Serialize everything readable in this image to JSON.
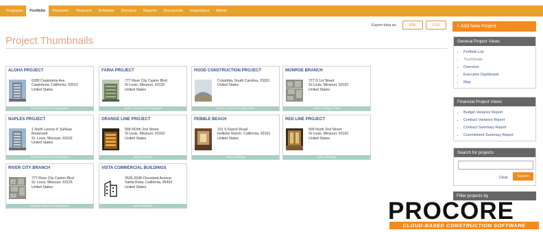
{
  "nav": {
    "items": [
      {
        "label": "Programs",
        "active": false
      },
      {
        "label": "Portfolio",
        "active": true
      },
      {
        "label": "Planroom",
        "active": false
      },
      {
        "label": "Timecard",
        "active": false
      },
      {
        "label": "Schedule",
        "active": false
      },
      {
        "label": "Directory",
        "active": false
      },
      {
        "label": "Reports",
        "active": false
      },
      {
        "label": "Documents",
        "active": false
      },
      {
        "label": "Inspections",
        "active": false
      },
      {
        "label": "Admin",
        "active": false
      }
    ]
  },
  "export": {
    "label": "Export data as:",
    "pdf": "PDF",
    "csv": "CSV"
  },
  "page_title": "Project Thumbnails",
  "projects": [
    {
      "name": "ALOHA PROJECT",
      "address": [
        "6309 Carpinteria Ave",
        "Carpinteria, California, 93013",
        "United States"
      ],
      "status": "Active | Course of Construction",
      "thumb": "tall-building"
    },
    {
      "name": "FARIA PROJECT",
      "address": [
        "777 River City Casino Blvd",
        "St Louis, Missouri, 63125",
        "United States"
      ],
      "status": "Active | Course of Construction",
      "thumb": "green-building"
    },
    {
      "name": "HOOD CONSTRUCTION PROJECT",
      "address": [
        "Columbia, South Carolina, 29201",
        "United States"
      ],
      "status": "Active | Course of Construction",
      "thumb": "arena"
    },
    {
      "name": "MONROE BRANCH",
      "address": [
        "727 N 1st Street",
        "St Louis, Missouri, 63102",
        "United States"
      ],
      "status": "Active | Design Phase",
      "thumb": "aerial"
    },
    {
      "name": "NAPLES PROJECT",
      "address": [
        "1 North Leonor K Sullivan",
        "Boulevard",
        "St. Louis, Missouri, 63102",
        "United States"
      ],
      "status": "Active | Course of Construction",
      "thumb": "tall-building"
    },
    {
      "name": "ORANGE LINE PROJECT",
      "address": [
        "999 NOrth 2nd Street",
        "St Louis, Missouri, 63102",
        "United States"
      ],
      "status": "Active | Bidding",
      "thumb": "night-building"
    },
    {
      "name": "PEBBLE BEACH",
      "address": [
        "101 S Ranch Road",
        "Hollister Ranch, California, 93101",
        "United States"
      ],
      "status": "Active | Bidding",
      "thumb": "interior"
    },
    {
      "name": "RED LINE PROJECT",
      "address": [
        "999 North 2nd Street",
        "St Louis, Missouri, 63102",
        "United States"
      ],
      "status": "Active | Bidding",
      "thumb": "lobby"
    },
    {
      "name": "RIVER CITY BRANCH",
      "address": [
        "777 River City Casino Blvd",
        "St. Louis, Missouri, 63125",
        "United States"
      ],
      "status": "Active | Course of Construction",
      "thumb": "aerial"
    },
    {
      "name": "VISTA COMMERCIAL BUILDINGS",
      "address": [
        "2636-2638 Cleveland Avenue",
        "Santa Rosa, California, 95403",
        "United States"
      ],
      "status": "Active | Bidding",
      "thumb": "building-icon"
    }
  ],
  "sidebar": {
    "add_button": "+ Add New Project",
    "general": {
      "title": "General Project Views",
      "items": [
        {
          "label": "Portfolio List",
          "muted": false
        },
        {
          "label": "Thumbnails",
          "muted": true
        },
        {
          "label": "Overview",
          "muted": false
        },
        {
          "label": "Executive Dashboard",
          "muted": false
        },
        {
          "label": "Map",
          "muted": false
        }
      ]
    },
    "financial": {
      "title": "Financial Project Views",
      "items": [
        {
          "label": "Budget Variance Report"
        },
        {
          "label": "Contract Variance Report"
        },
        {
          "label": "Contract Summary Report"
        },
        {
          "label": "Commitment Summary Report"
        }
      ]
    },
    "search": {
      "title": "Search for projects",
      "clear": "Clear",
      "button": "Search",
      "value": ""
    },
    "filter": {
      "title": "Filter projects by"
    }
  },
  "logo": {
    "word": "PROCORE",
    "tagline": "CLOUD-BASED CONSTRUCTION SOFTWARE"
  },
  "colors": {
    "nav": "#e8a12a",
    "accent": "#f28a1f",
    "link": "#34508c",
    "status": "#a8cfc3"
  }
}
